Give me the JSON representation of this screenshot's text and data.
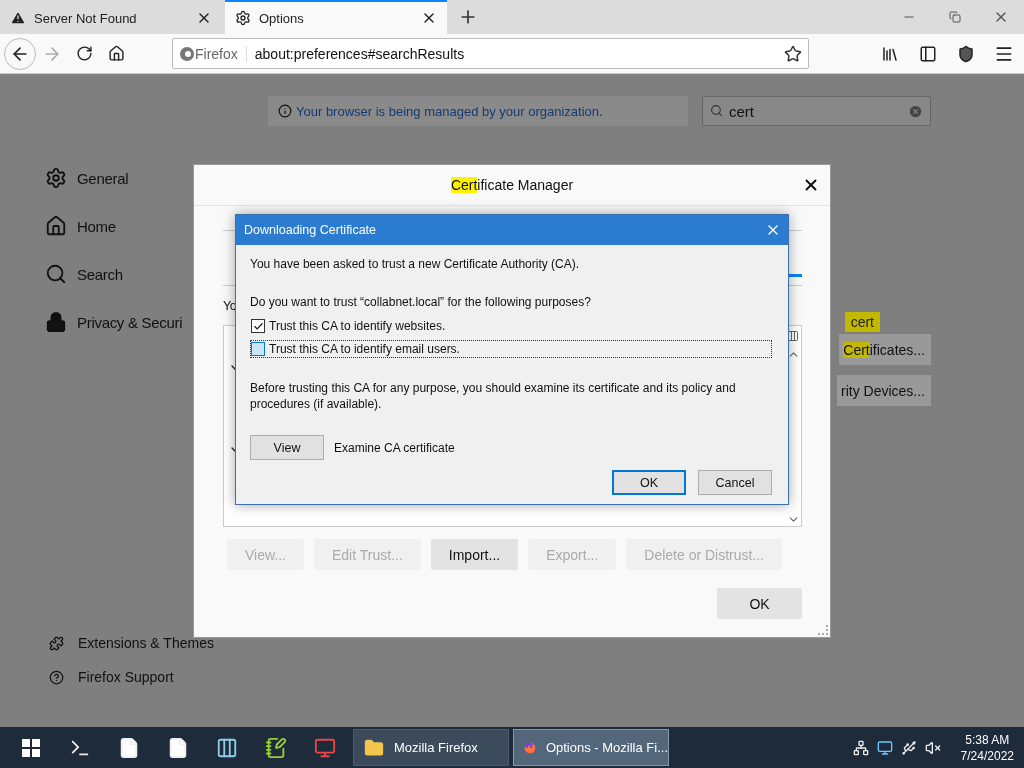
{
  "browser": {
    "tabs": [
      {
        "title": "Server Not Found",
        "selected": false
      },
      {
        "title": "Options",
        "selected": true
      }
    ],
    "identity": "Firefox",
    "url": "about:preferences#searchResults"
  },
  "page": {
    "managed_notice": "Your browser is being managed by your organization.",
    "search": {
      "value": "cert"
    },
    "sidebar": [
      {
        "label": "General"
      },
      {
        "label": "Home"
      },
      {
        "label": "Search"
      },
      {
        "label": "Privacy & Securi"
      }
    ],
    "footer_links": [
      "Extensions & Themes",
      "Firefox Support"
    ],
    "result_badge": "cert",
    "result_buttons": [
      {
        "highlight": "Cert",
        "rest": "ificates..."
      },
      {
        "rest": "rity Devices..."
      }
    ]
  },
  "cert_manager": {
    "title": {
      "highlight": "Cert",
      "rest": "ificate Manager"
    },
    "intro": "Yo",
    "buttons": [
      {
        "label": "View...",
        "disabled": true
      },
      {
        "label": "Edit Trust...",
        "disabled": true
      },
      {
        "label": "Import...",
        "disabled": false
      },
      {
        "label": "Export...",
        "disabled": true
      },
      {
        "label": "Delete or Distrust...",
        "disabled": true
      }
    ],
    "ok": "OK"
  },
  "dialog": {
    "title": "Downloading Certificate",
    "message": "You have been asked to trust a new Certificate Authority (CA).",
    "question": "Do you want to trust “collabnet.local” for the following purposes?",
    "options": [
      {
        "label": "Trust this CA to identify websites.",
        "checked": true,
        "focused": false
      },
      {
        "label": "Trust this CA to identify email users.",
        "checked": false,
        "focused": true
      }
    ],
    "advice": "Before trusting this CA for any purpose, you should examine its certificate and its policy and procedures (if available).",
    "view_button": "View",
    "view_label": "Examine CA certificate",
    "ok": "OK",
    "cancel": "Cancel"
  },
  "taskbar": {
    "tasks": [
      {
        "label": "Mozilla Firefox",
        "selected": false
      },
      {
        "label": "Options - Mozilla Fi...",
        "selected": true
      }
    ],
    "time": "5:38 AM",
    "date": "7/24/2022"
  }
}
